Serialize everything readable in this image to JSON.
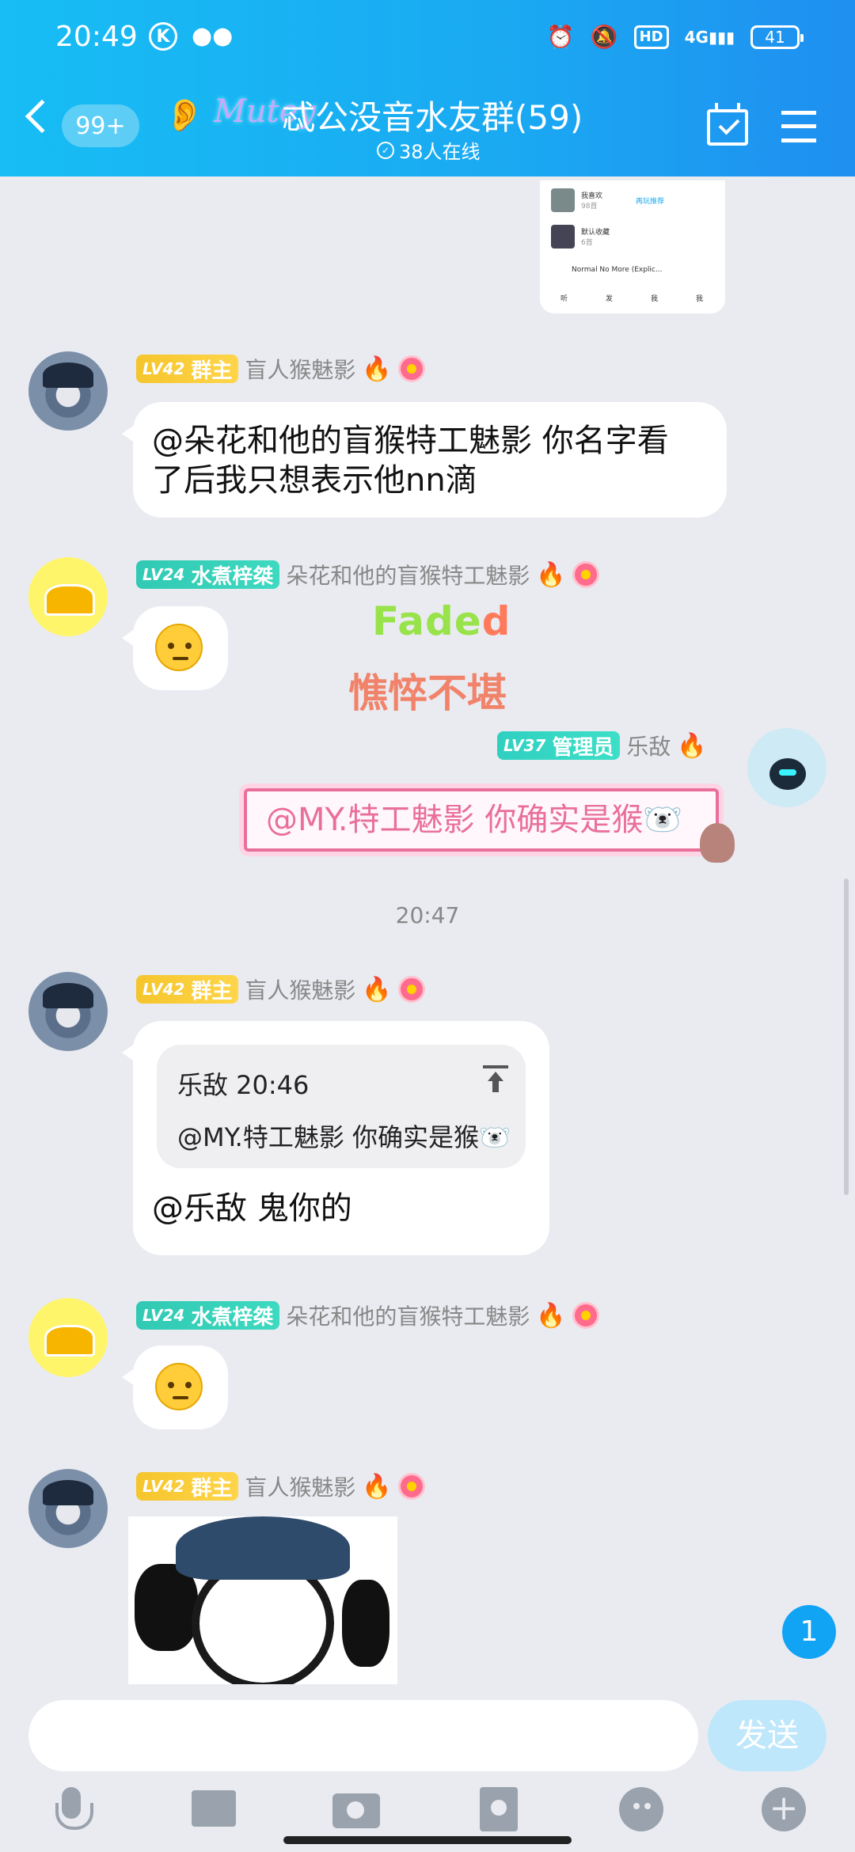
{
  "status_bar": {
    "time": "20:49",
    "k_icon": "K",
    "hd": "HD",
    "net": "4G",
    "battery": "41"
  },
  "header": {
    "unread_badge": "99+",
    "logo_text": "Mutey",
    "title": "忒公没音水友群(59)",
    "online": "38人在线"
  },
  "thumb": {
    "row1": "我喜欢",
    "row1_sub": "98首",
    "row1_btn": "再玩推荐",
    "row2": "默认收藏",
    "row2_sub": "6首",
    "player": "Normal No More (Explic...",
    "nav": [
      "听",
      "发",
      "我",
      "我"
    ]
  },
  "messages": [
    {
      "avatar": "pirate",
      "lv": "LV42",
      "role": "群主",
      "name": "盲人猴魅影",
      "text_line1": "@朵花和他的盲猴特工魅影 你名字看",
      "text_line2": "了后我只想表示他nn滴"
    },
    {
      "avatar": "pudding",
      "lv": "LV24",
      "role": "水煮梓桀",
      "name": "朵花和他的盲猴特工魅影"
    },
    {
      "avatar": "robot",
      "lv": "LV37",
      "role": "管理员",
      "name": "乐敌",
      "text": "@MY.特工魅影 你确实是猴🐻‍❄️"
    },
    {
      "avatar": "pirate",
      "lv": "LV42",
      "role": "群主",
      "name": "盲人猴魅影",
      "quote_head": "乐敌 20:46",
      "quote_text": "@MY.特工魅影 你确实是猴🐻‍❄️",
      "text": "@乐敌 鬼你的"
    },
    {
      "avatar": "pudding",
      "lv": "LV24",
      "role": "水煮梓桀",
      "name": "朵花和他的盲猴特工魅影"
    },
    {
      "avatar": "pirate",
      "lv": "LV42",
      "role": "群主",
      "name": "盲人猴魅影"
    }
  ],
  "faded": {
    "part1": "Fade",
    "part2": "d",
    "sub": "憔悴不堪"
  },
  "timestamp": "20:47",
  "unread_count": "1",
  "input": {
    "placeholder": "",
    "send": "发送"
  },
  "colors": {
    "header_start": "#17bdf4",
    "header_end": "#1f8ff0",
    "owner_badge": "#f5c52c",
    "teal_badge": "#31c9b3",
    "send_btn": "#bfe7fb"
  }
}
